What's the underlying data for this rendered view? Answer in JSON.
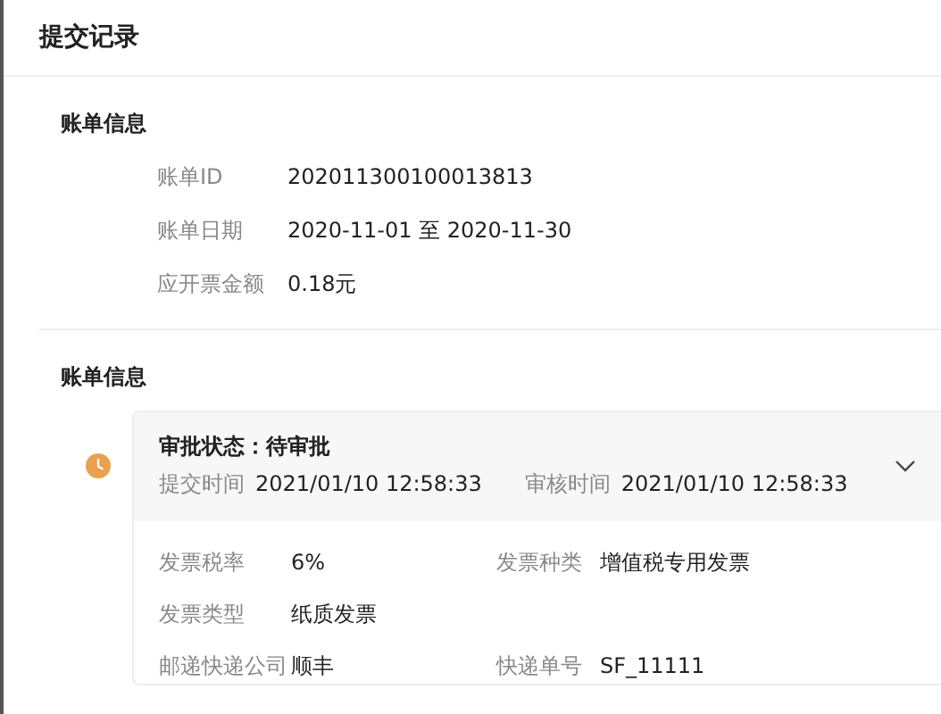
{
  "header": {
    "title": "提交记录"
  },
  "bill_section": {
    "title": "账单信息",
    "fields": [
      {
        "label": "账单ID",
        "value": "202011300100013813"
      },
      {
        "label": "账单日期",
        "value": "2020-11-01 至 2020-11-30"
      },
      {
        "label": "应开票金额",
        "value": "0.18元"
      }
    ]
  },
  "approval_section": {
    "title": "账单信息",
    "record": {
      "status_label": "审批状态：",
      "status": "待审批",
      "submit_label": "提交时间",
      "submit_time": "2021/01/10 12:58:33",
      "review_label": "审核时间",
      "review_time": "2021/01/10 12:58:33",
      "expanded": true,
      "details": [
        [
          {
            "label": "发票税率",
            "value": "6%"
          },
          {
            "label": "发票种类",
            "value": "增值税专用发票"
          }
        ],
        [
          {
            "label": "发票类型",
            "value": "纸质发票"
          }
        ],
        [
          {
            "label": "邮递快递公司",
            "value": "顺丰"
          },
          {
            "label": "快递单号",
            "value": "SF_11111"
          }
        ]
      ]
    }
  }
}
